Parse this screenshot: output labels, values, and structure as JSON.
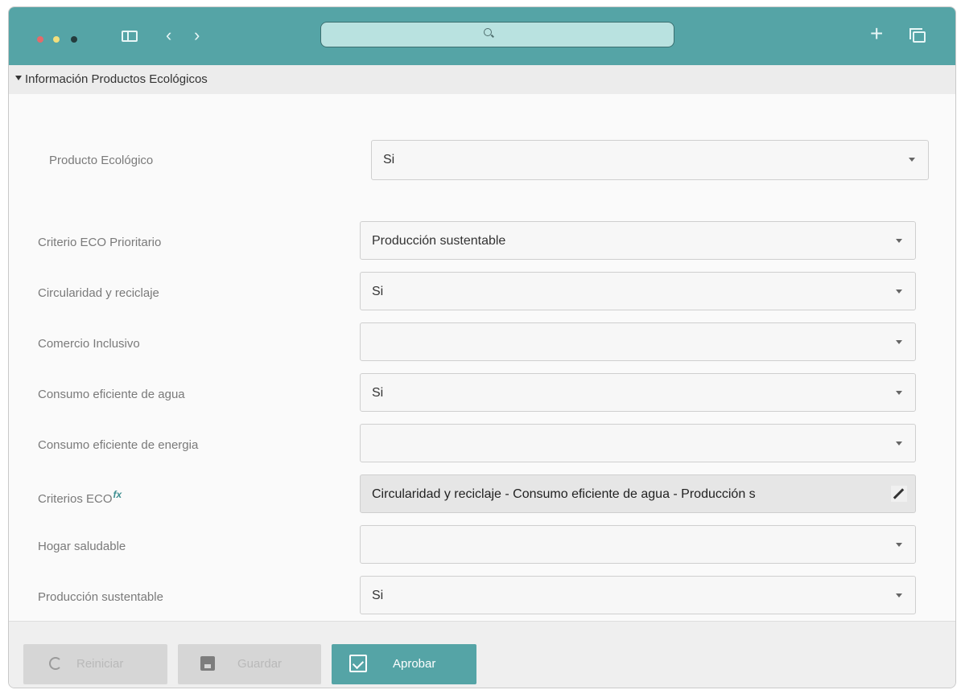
{
  "browser": {
    "icons": {
      "sidebar_toggle": "sidebar-toggle-icon",
      "back": "chevron-left-icon",
      "forward": "chevron-right-icon",
      "search": "search-icon",
      "new_tab": "plus-icon",
      "tabs_overview": "tabs-overview-icon"
    },
    "url_placeholder": ""
  },
  "section": {
    "title": "Información Productos Ecológicos"
  },
  "form": {
    "fields": [
      {
        "label": "Producto Ecológico",
        "value": "Si"
      },
      {
        "label": "Criterio ECO Prioritario",
        "value": "Producción sustentable"
      },
      {
        "label": "Circularidad y reciclaje",
        "value": "Si"
      },
      {
        "label": "Comercio Inclusivo",
        "value": ""
      },
      {
        "label": "Consumo eficiente de agua",
        "value": "Si"
      },
      {
        "label": "Consumo eficiente de energia",
        "value": ""
      },
      {
        "label": "Criterios ECO",
        "value": "Circularidad y reciclaje - Consumo eficiente de agua - Producción s"
      },
      {
        "label": "Hogar saludable",
        "value": ""
      },
      {
        "label": "Producción sustentable",
        "value": "Si"
      }
    ],
    "formula_marker": "fx"
  },
  "footer": {
    "buttons": {
      "reload": "Reiniciar",
      "save": "Guardar",
      "approve": "Aprobar"
    }
  },
  "colors": {
    "accent": "#55a4a6",
    "titlebar": "#55a4a6",
    "disabled_button": "#d6d6d6"
  }
}
